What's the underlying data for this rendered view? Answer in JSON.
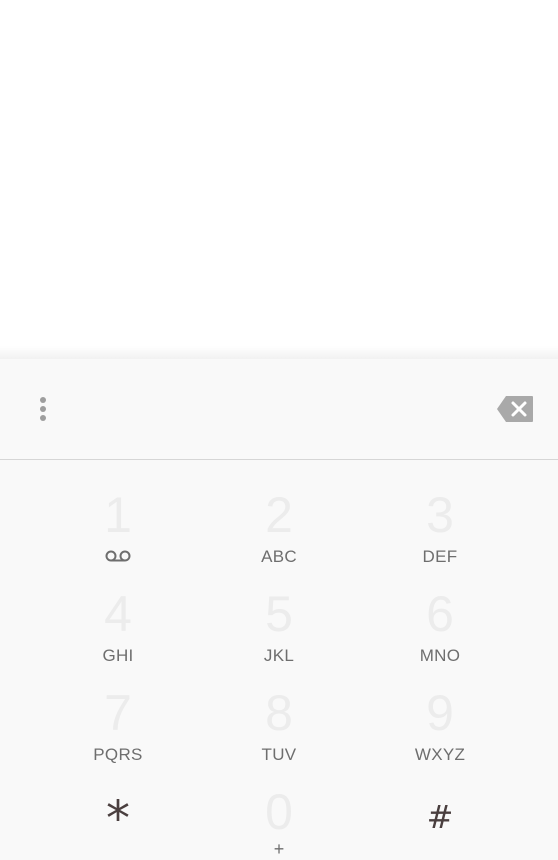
{
  "dialer": {
    "digits_value": "",
    "overflow_icon": "more-vert-icon",
    "backspace_icon": "backspace-icon",
    "keys": [
      {
        "digit": "1",
        "letters": "",
        "icon": "voicemail-icon"
      },
      {
        "digit": "2",
        "letters": "ABC"
      },
      {
        "digit": "3",
        "letters": "DEF"
      },
      {
        "digit": "4",
        "letters": "GHI"
      },
      {
        "digit": "5",
        "letters": "JKL"
      },
      {
        "digit": "6",
        "letters": "MNO"
      },
      {
        "digit": "7",
        "letters": "PQRS"
      },
      {
        "digit": "8",
        "letters": "TUV"
      },
      {
        "digit": "9",
        "letters": "WXYZ"
      },
      {
        "symbol": "*"
      },
      {
        "digit": "0",
        "letters": "+"
      },
      {
        "symbol": "#"
      }
    ]
  },
  "colors": {
    "dialer_background": "#f9f9f9",
    "digit_color": "#ececec",
    "letters_color": "#6e6e6e",
    "symbol_color": "#4a3f3f",
    "icon_color": "#9e9e9e"
  }
}
